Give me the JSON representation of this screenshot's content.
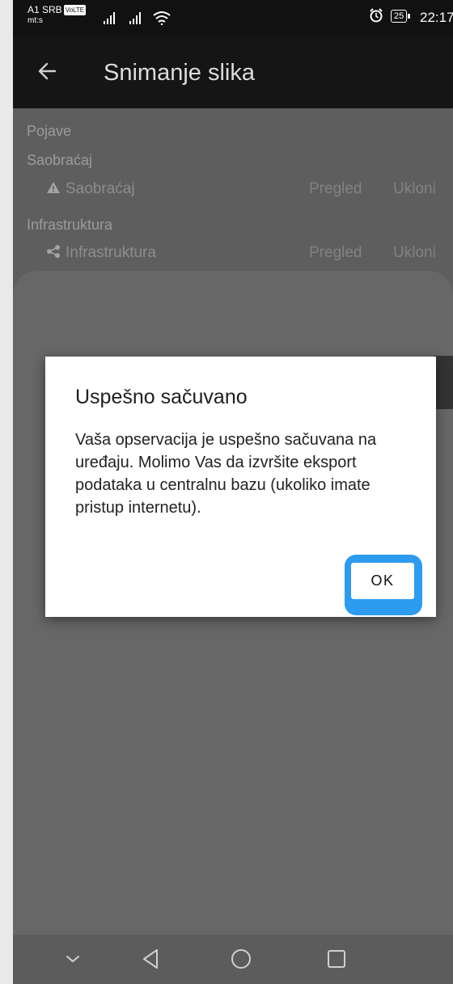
{
  "status_bar": {
    "carrier": "A1 SRB",
    "volte": "VoLTE",
    "network_sub": "mt:s",
    "battery": "25",
    "time": "22:17"
  },
  "app_bar": {
    "title": "Snimanje slika"
  },
  "content": {
    "sections": [
      {
        "heading": "Pojave",
        "groups": [
          {
            "heading": "Saobraćaj",
            "item_label": "Saobraćaj",
            "icon": "warning-icon",
            "actions": [
              "Pregled",
              "Ukloni"
            ]
          }
        ]
      },
      {
        "heading": "Infrastruktura",
        "item_label": "Infrastruktura",
        "icon": "share-icon",
        "actions": [
          "Pregled",
          "Ukloni"
        ]
      }
    ]
  },
  "dialog": {
    "title": "Uspešno sačuvano",
    "message": "Vaša opservacija je uspešno sačuvana na uređaju. Molimo Vas da izvršite eksport podataka u centralnu bazu (ukoliko imate pristup internetu).",
    "ok_label": "OK",
    "highlight_color": "#2d9bf0"
  },
  "nav_bar": {
    "buttons": [
      "chevron-down-icon",
      "back-triangle-icon",
      "home-circle-icon",
      "recents-square-icon"
    ]
  }
}
